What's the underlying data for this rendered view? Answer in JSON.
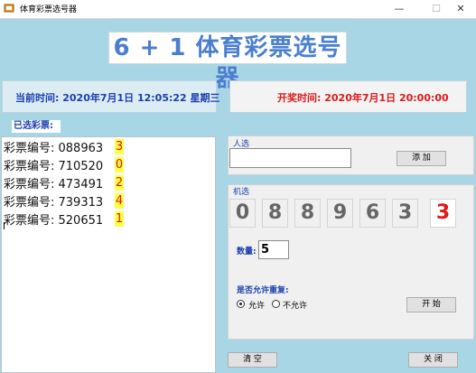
{
  "window": {
    "title": "体育彩票选号器",
    "minimize": "—",
    "maximize": "☐",
    "close": "✕"
  },
  "header": {
    "title": "6 + 1 体育彩票选号器",
    "title_color": "#4a7fd0"
  },
  "current_time": {
    "text": "当前时间:  2020年7月1日  12:05:22  星期三",
    "color": "#1a3fb0"
  },
  "draw_time": {
    "text": "开奖时间:  2020年7月1日  20:00:00",
    "color": "#d91b1b"
  },
  "selected": {
    "label": "已选彩票:",
    "tickets": [
      {
        "prefix": "彩票编号: 088963",
        "special": "3"
      },
      {
        "prefix": "彩票编号: 710520",
        "special": "0"
      },
      {
        "prefix": "彩票编号: 473491",
        "special": "2"
      },
      {
        "prefix": "彩票编号: 739313",
        "special": "4"
      },
      {
        "prefix": "彩票编号: 520651",
        "special": "1"
      }
    ]
  },
  "manual": {
    "group_label": "人选",
    "input_value": "",
    "add_label": "添 加"
  },
  "machine": {
    "group_label": "机选",
    "digits": [
      "0",
      "8",
      "8",
      "9",
      "6",
      "3"
    ],
    "special_digit": "3",
    "quantity_label": "数量:",
    "quantity_value": "5",
    "repeat_label": "是否允许重复:",
    "allow_label": "允许",
    "disallow_label": "不允许",
    "allow_selected": true,
    "start_label": "开 始"
  },
  "footer": {
    "clear_label": "清 空",
    "close_label": "关 闭"
  },
  "colors": {
    "background": "#a9d6e5",
    "special_digit": "#e01818",
    "highlight": "#ffff44"
  }
}
